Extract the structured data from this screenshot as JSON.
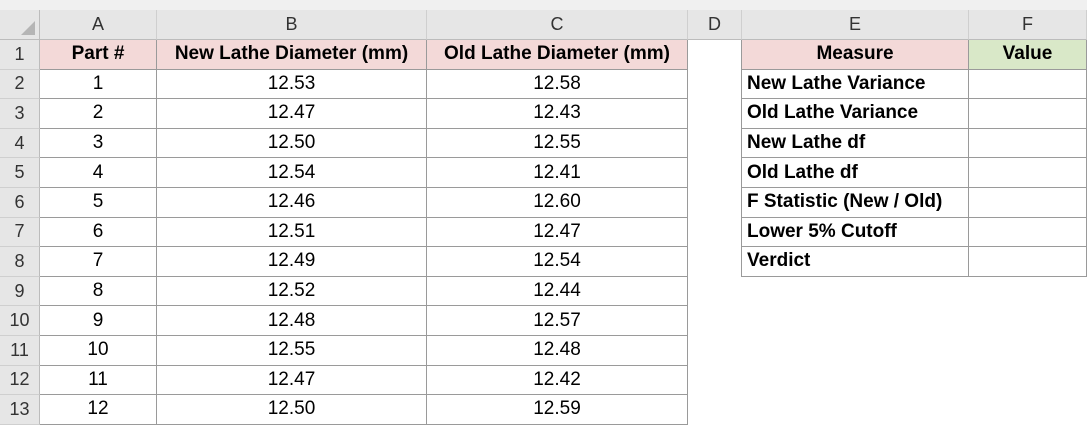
{
  "columns": [
    "A",
    "B",
    "C",
    "D",
    "E",
    "F"
  ],
  "row_numbers": [
    "1",
    "2",
    "3",
    "4",
    "5",
    "6",
    "7",
    "8",
    "9",
    "10",
    "11",
    "12",
    "13"
  ],
  "data_table": {
    "headers": [
      "Part #",
      "New Lathe Diameter (mm)",
      "Old Lathe Diameter (mm)"
    ],
    "rows": [
      [
        "1",
        "12.53",
        "12.58"
      ],
      [
        "2",
        "12.47",
        "12.43"
      ],
      [
        "3",
        "12.50",
        "12.55"
      ],
      [
        "4",
        "12.54",
        "12.41"
      ],
      [
        "5",
        "12.46",
        "12.60"
      ],
      [
        "6",
        "12.51",
        "12.47"
      ],
      [
        "7",
        "12.49",
        "12.54"
      ],
      [
        "8",
        "12.52",
        "12.44"
      ],
      [
        "9",
        "12.48",
        "12.57"
      ],
      [
        "10",
        "12.55",
        "12.48"
      ],
      [
        "11",
        "12.47",
        "12.42"
      ],
      [
        "12",
        "12.50",
        "12.59"
      ]
    ]
  },
  "measure_table": {
    "headers": [
      "Measure",
      "Value"
    ],
    "rows": [
      [
        "New Lathe Variance",
        ""
      ],
      [
        "Old Lathe Variance",
        ""
      ],
      [
        "New Lathe df",
        ""
      ],
      [
        "Old Lathe df",
        ""
      ],
      [
        "F Statistic (New / Old)",
        ""
      ],
      [
        "Lower 5% Cutoff",
        ""
      ],
      [
        "Verdict",
        ""
      ]
    ]
  },
  "colors": {
    "header_pink": "#f3d9d8",
    "header_green": "#d9e8c8",
    "grid_header_bg": "#e6e6e6"
  }
}
